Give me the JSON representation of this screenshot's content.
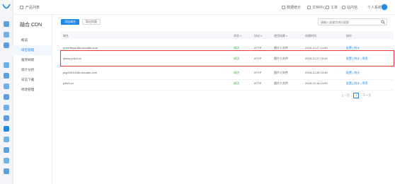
{
  "topbar": {
    "breadcrumb": "产品列表",
    "links": [
      "数据统计",
      "文档中心",
      "工单",
      "站内信",
      "个人系统"
    ]
  },
  "sidebar": {
    "title": "融合 CDN",
    "items": [
      "概览",
      "域名管理",
      "缓存刷新",
      "统计分析",
      "日志下载",
      "修改管理"
    ],
    "active_index": 1
  },
  "toolbar": {
    "add_label": "添加域名",
    "export_label": "导出列表",
    "search_placeholder": "请输入关键字进行搜索"
  },
  "table": {
    "headers": [
      "域名",
      "状态",
      "协议",
      "使用场景",
      "创建时间",
      "操作"
    ],
    "rows": [
      {
        "domain": "pubs4tepa.bkt.clouddn.com",
        "status": "成功",
        "protocol": "HTTP",
        "scene": "图片小文件",
        "created": "2018-12-27 14:59",
        "ops": "配置 | 统计"
      },
      {
        "domain": "qssss.pdiv4.cn",
        "status": "成功",
        "protocol": "HTTP",
        "scene": "图片小文件",
        "created": "2018-12-27 15:45",
        "ops": "配置 | 统计 | 停用"
      },
      {
        "domain": "pqp1d944.bkt.clouddn.com",
        "status": "成功",
        "protocol": "HTTP",
        "scene": "图片小文件",
        "created": "2018-12-28 13:45",
        "ops": "配置 | 统计"
      },
      {
        "domain": "pdiv4.cn",
        "status": "成功",
        "protocol": "HTTP",
        "scene": "图片小文件",
        "created": "2018-12-18 13:50",
        "ops": "配置 | 统计 | 停用"
      }
    ],
    "highlighted_row": 1
  },
  "pagination": {
    "prev": "上一页",
    "current": "1",
    "next": "下一页"
  },
  "colors": {
    "accent": "#1e88e5",
    "success": "#2aa541",
    "highlight": "#e53935"
  }
}
